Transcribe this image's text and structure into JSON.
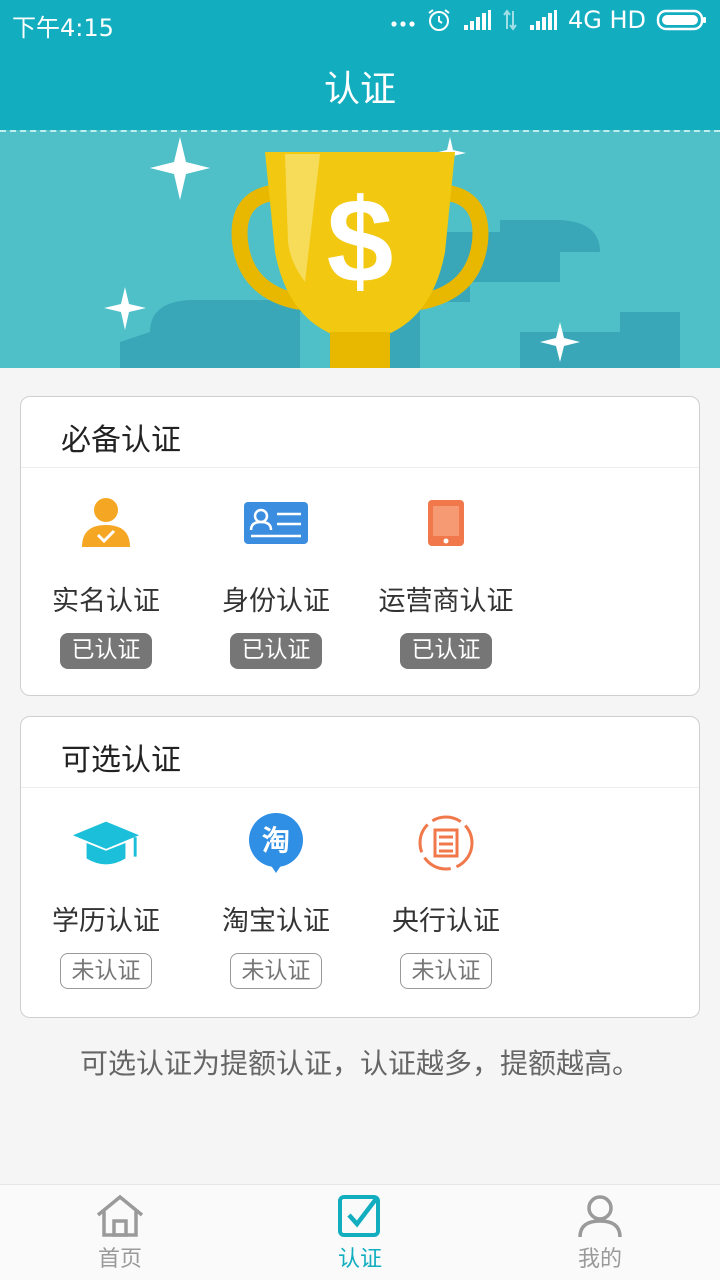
{
  "status_bar": {
    "time": "下午4:15",
    "network_label": "4G HD"
  },
  "header": {
    "title": "认证"
  },
  "required_section": {
    "title": "必备认证",
    "items": [
      {
        "label": "实名认证",
        "status": "已认证",
        "icon": "person-check-icon",
        "icon_color": "#f5a623",
        "verified": true
      },
      {
        "label": "身份认证",
        "status": "已认证",
        "icon": "id-card-icon",
        "icon_color": "#3b8de0",
        "verified": true
      },
      {
        "label": "运营商认证",
        "status": "已认证",
        "icon": "mobile-phone-icon",
        "icon_color": "#f0784a",
        "verified": true
      }
    ]
  },
  "optional_section": {
    "title": "可选认证",
    "items": [
      {
        "label": "学历认证",
        "status": "未认证",
        "icon": "graduation-cap-icon",
        "icon_color": "#1bbfd9",
        "verified": false
      },
      {
        "label": "淘宝认证",
        "status": "未认证",
        "icon": "taobao-icon",
        "icon_color": "#2f8fe4",
        "icon_text": "淘",
        "verified": false
      },
      {
        "label": "央行认证",
        "status": "未认证",
        "icon": "central-bank-icon",
        "icon_color": "#f0784a",
        "verified": false
      }
    ]
  },
  "footnote": "可选认证为提额认证，认证越多，提额越高。",
  "bottom_nav": [
    {
      "label": "首页",
      "icon": "home-icon",
      "active": false
    },
    {
      "label": "认证",
      "icon": "checkbox-icon",
      "active": true
    },
    {
      "label": "我的",
      "icon": "user-icon",
      "active": false
    }
  ],
  "colors": {
    "primary": "#12aec0",
    "banner_bg": "#4fc0c8",
    "badge_done": "#767676"
  }
}
